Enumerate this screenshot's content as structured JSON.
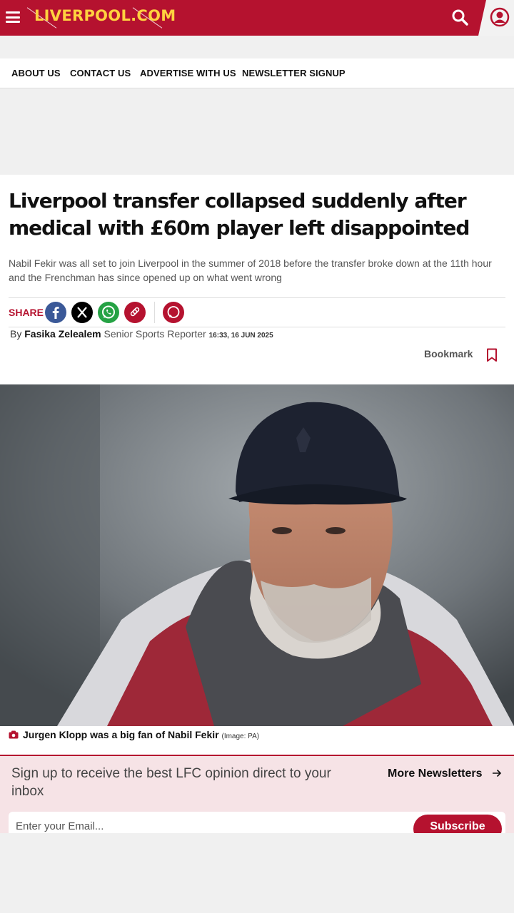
{
  "header": {
    "logo_text": "LIVERPOOL.COM",
    "brand_color": "#b5122f",
    "logo_color": "#ffd23f",
    "menu_icon": "hamburger-icon",
    "search_icon": "search-icon",
    "account_icon": "user-account-icon"
  },
  "nav": {
    "items": [
      {
        "label": "ABOUT US"
      },
      {
        "label": "CONTACT US"
      },
      {
        "label": "ADVERTISE WITH US"
      },
      {
        "label": "NEWSLETTER SIGNUP"
      }
    ]
  },
  "article": {
    "headline": "Liverpool transfer collapsed suddenly after medical with £60m player left disappointed",
    "standfirst": "Nabil Fekir was all set to join Liverpool in the summer of 2018 before the transfer broke down at the 11th hour and the Frenchman has since opened up on what went wrong",
    "share_label": "SHARE",
    "share_icons": [
      "facebook-icon",
      "x-icon",
      "whatsapp-icon",
      "copy-link-icon",
      "comments-icon"
    ],
    "byline_prefix": "By",
    "author": "Fasika Zelealem",
    "author_role": "Senior Sports Reporter",
    "timestamp": "16:33, 16 JUN 2025",
    "bookmark_label": "Bookmark"
  },
  "image": {
    "caption": "Jurgen Klopp was a big fan of Nabil Fekir",
    "credit": "(Image: PA)"
  },
  "newsletter": {
    "text": "Sign up to receive the best LFC opinion direct to your inbox",
    "more_label": "More Newsletters",
    "input_placeholder": "Enter your Email...",
    "subscribe_label": "Subscribe"
  }
}
